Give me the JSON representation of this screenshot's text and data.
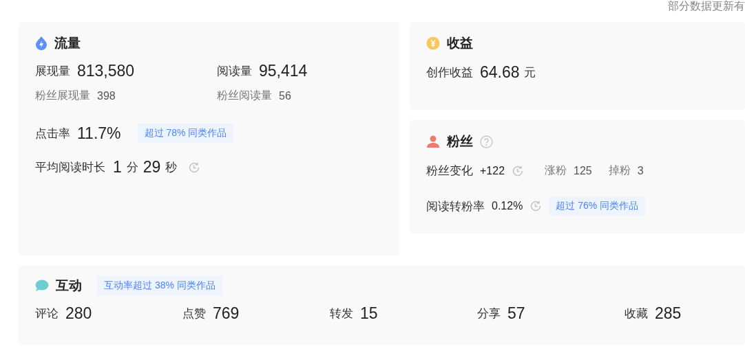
{
  "update_note": "部分数据更新有",
  "traffic": {
    "title": "流量",
    "metrics": [
      {
        "label": "展现量",
        "value": "813,580",
        "sub_label": "粉丝展现量",
        "sub_value": "398"
      },
      {
        "label": "阅读量",
        "value": "95,414",
        "sub_label": "粉丝阅读量",
        "sub_value": "56"
      }
    ],
    "click_rate": {
      "label": "点击率",
      "value": "11.7%",
      "badge": "超过 78% 同类作品"
    },
    "avg_read": {
      "label": "平均阅读时长",
      "parts": [
        {
          "kind": "number",
          "text": "1"
        },
        {
          "kind": "unit",
          "text": "分"
        },
        {
          "kind": "number",
          "text": "29"
        },
        {
          "kind": "unit",
          "text": "秒"
        }
      ]
    }
  },
  "income": {
    "title": "收益",
    "label": "创作收益",
    "value": "64.68",
    "unit": "元"
  },
  "fans": {
    "title": "粉丝",
    "change": {
      "label": "粉丝变化",
      "value": "+122"
    },
    "gain": {
      "label": "涨粉",
      "value": "125"
    },
    "loss": {
      "label": "掉粉",
      "value": "3"
    },
    "conversion": {
      "label": "阅读转粉率",
      "value": "0.12%",
      "badge": "超过 76% 同类作品"
    }
  },
  "interaction": {
    "title": "互动",
    "badge": "互动率超过 38% 同类作品",
    "metrics": [
      {
        "label": "评论",
        "value": "280"
      },
      {
        "label": "点赞",
        "value": "769"
      },
      {
        "label": "转发",
        "value": "15"
      },
      {
        "label": "分享",
        "value": "57"
      },
      {
        "label": "收藏",
        "value": "285"
      }
    ]
  }
}
